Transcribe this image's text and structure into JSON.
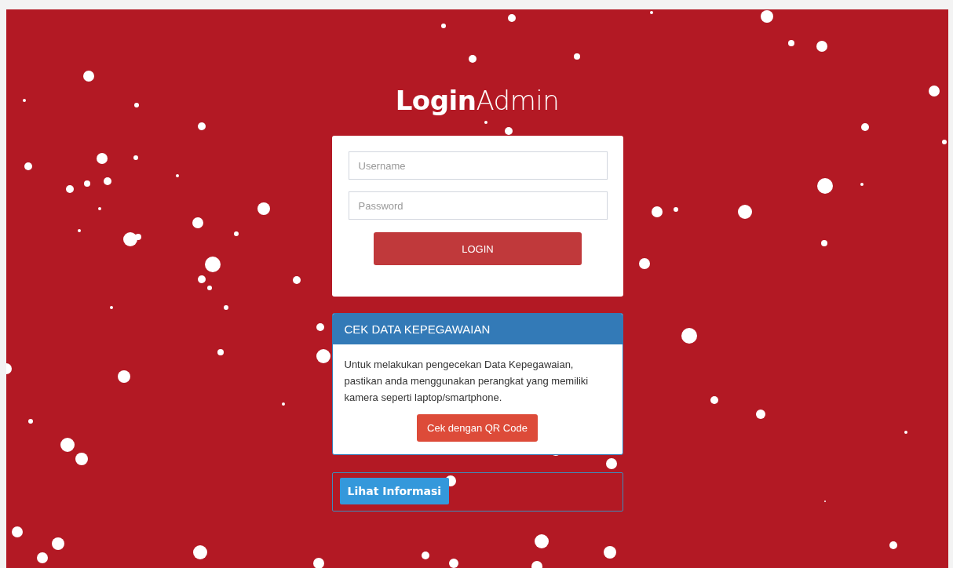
{
  "title": "**Login**Admin",
  "login": {
    "username": {
      "placeholder": "Username"
    },
    "password": {
      "placeholder": "Password"
    },
    "button": "LOGIN"
  },
  "panel": {
    "title": "CEK DATA KEPEGAWAIAN",
    "text": "Untuk melakukan pengecekan Data Kepegawaian, pastikan anda menggunakan perangkat yang memiliki kamera seperti laptop/smartphone.",
    "button": "Cek dengan QR Code"
  },
  "info": {
    "button": "Lihat Informasi"
  }
}
